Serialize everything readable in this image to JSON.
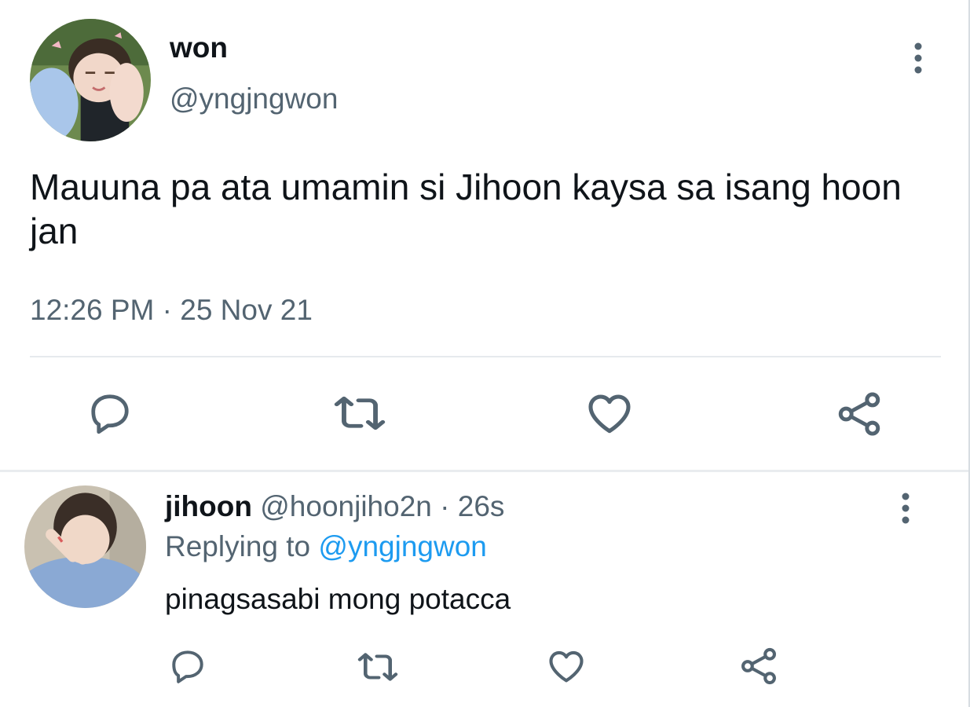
{
  "colors": {
    "text": "#0f1419",
    "secondary": "#536471",
    "link": "#1d9bf0",
    "divider": "#e6eaed"
  },
  "tweet": {
    "display_name": "won",
    "handle": "@yngjngwon",
    "text": "Mauuna pa ata umamin si Jihoon kaysa sa isang hoon jan",
    "timestamp": "12:26 PM · 25 Nov 21",
    "actions": [
      "reply-icon",
      "retweet-icon",
      "like-icon",
      "share-icon"
    ]
  },
  "reply": {
    "display_name": "jihoon",
    "handle": "@hoonjiho2n",
    "separator": "·",
    "time": "26s",
    "replying_prefix": "Replying to",
    "replying_to": "@yngjngwon",
    "text": "pinagsasabi mong potacca",
    "actions": [
      "reply-icon",
      "retweet-icon",
      "like-icon",
      "share-icon"
    ]
  }
}
